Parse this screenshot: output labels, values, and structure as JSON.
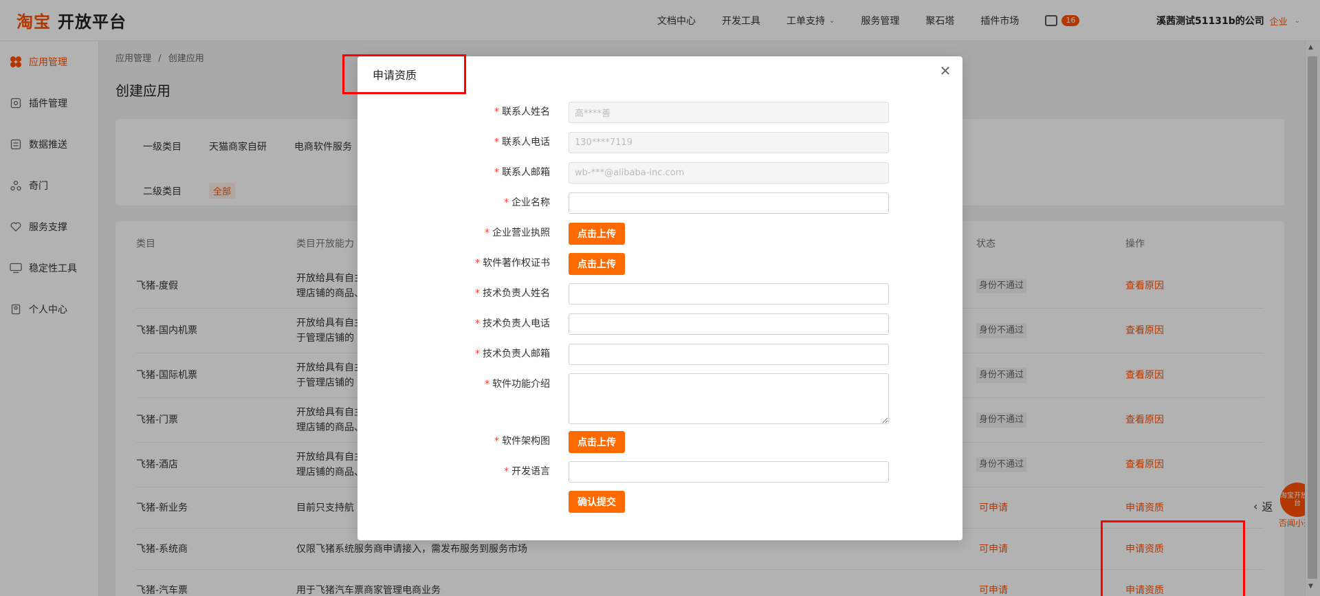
{
  "header": {
    "logo_taobao": "淘宝",
    "logo_platform": "开放平台",
    "nav": [
      "文档中心",
      "开发工具",
      "工单支持",
      "服务管理",
      "聚石塔",
      "插件市场"
    ],
    "messages_count": "16",
    "account_name": "溪茜测试51131b的公司",
    "account_tag": "企业"
  },
  "sidebar": {
    "items": [
      {
        "label": "应用管理",
        "icon": "app-grid-icon"
      },
      {
        "label": "插件管理",
        "icon": "plugin-icon"
      },
      {
        "label": "数据推送",
        "icon": "data-push-icon"
      },
      {
        "label": "奇门",
        "icon": "qimen-icon"
      },
      {
        "label": "服务支撑",
        "icon": "heart-icon"
      },
      {
        "label": "稳定性工具",
        "icon": "monitor-icon"
      },
      {
        "label": "个人中心",
        "icon": "profile-icon"
      }
    ]
  },
  "main": {
    "breadcrumb": [
      "应用管理",
      "创建应用"
    ],
    "breadcrumb_sep": "/",
    "title": "创建应用",
    "filters": {
      "level1_label": "一级类目",
      "level1_options": [
        "天猫商家自研",
        "电商软件服务"
      ],
      "level2_label": "二级类目",
      "level2_selected": "全部"
    },
    "table": {
      "headers": [
        "类目",
        "类目开放能力",
        "状态",
        "操作"
      ],
      "rows": [
        {
          "category": "飞猪-度假",
          "desc1": "开放给具有自主",
          "desc2": "理店铺的商品、",
          "status": "身份不通过",
          "status_type": "fail",
          "action": "查看原因"
        },
        {
          "category": "飞猪-国内机票",
          "desc1": "开放给具有自主",
          "desc2": "于管理店铺的",
          "status": "身份不通过",
          "status_type": "fail",
          "action": "查看原因"
        },
        {
          "category": "飞猪-国际机票",
          "desc1": "开放给具有自主",
          "desc2": "于管理店铺的",
          "status": "身份不通过",
          "status_type": "fail",
          "action": "查看原因"
        },
        {
          "category": "飞猪-门票",
          "desc1": "开放给具有自主",
          "desc2": "理店铺的商品、",
          "status": "身份不通过",
          "status_type": "fail",
          "action": "查看原因"
        },
        {
          "category": "飞猪-酒店",
          "desc1": "开放给具有自主",
          "desc2": "理店铺的商品、",
          "status": "身份不通过",
          "status_type": "fail",
          "action": "查看原因"
        },
        {
          "category": "飞猪-新业务",
          "desc1": "目前只支持航",
          "desc2": "",
          "status": "可申请",
          "status_type": "ok",
          "action": "申请资质"
        },
        {
          "category": "飞猪-系统商",
          "desc1": "仅限飞猪系统服务商申请接入，需发布服务到服务市场",
          "desc2": "",
          "status": "可申请",
          "status_type": "ok",
          "action": "申请资质"
        },
        {
          "category": "飞猪-汽车票",
          "desc1": "用于飞猪汽车票商家管理电商业务",
          "desc2": "",
          "status": "可申请",
          "status_type": "ok",
          "action": "申请资质"
        }
      ]
    }
  },
  "float": {
    "back_label": "返",
    "logo_text": "淘宝开放平台",
    "caption": "否闻小开"
  },
  "modal": {
    "title": "申请资质",
    "fields": [
      {
        "label": "联系人姓名",
        "type": "disabled",
        "value": "高****善"
      },
      {
        "label": "联系人电话",
        "type": "disabled",
        "value": "130****7119"
      },
      {
        "label": "联系人邮箱",
        "type": "disabled",
        "value": "wb-***@alibaba-inc.com"
      },
      {
        "label": "企业名称",
        "type": "input",
        "value": ""
      },
      {
        "label": "企业营业执照",
        "type": "upload",
        "value": "点击上传"
      },
      {
        "label": "软件著作权证书",
        "type": "upload",
        "value": "点击上传"
      },
      {
        "label": "技术负责人姓名",
        "type": "input",
        "value": ""
      },
      {
        "label": "技术负责人电话",
        "type": "input",
        "value": ""
      },
      {
        "label": "技术负责人邮箱",
        "type": "input",
        "value": ""
      },
      {
        "label": "软件功能介绍",
        "type": "textarea",
        "value": ""
      },
      {
        "label": "软件架构图",
        "type": "upload",
        "value": "点击上传"
      },
      {
        "label": "开发语言",
        "type": "input",
        "value": ""
      }
    ],
    "required_mark": "*",
    "submit_label": "确认提交"
  },
  "colors": {
    "brand": "#ff5000",
    "button": "#ff6a00",
    "highlight": "#ff0000"
  }
}
